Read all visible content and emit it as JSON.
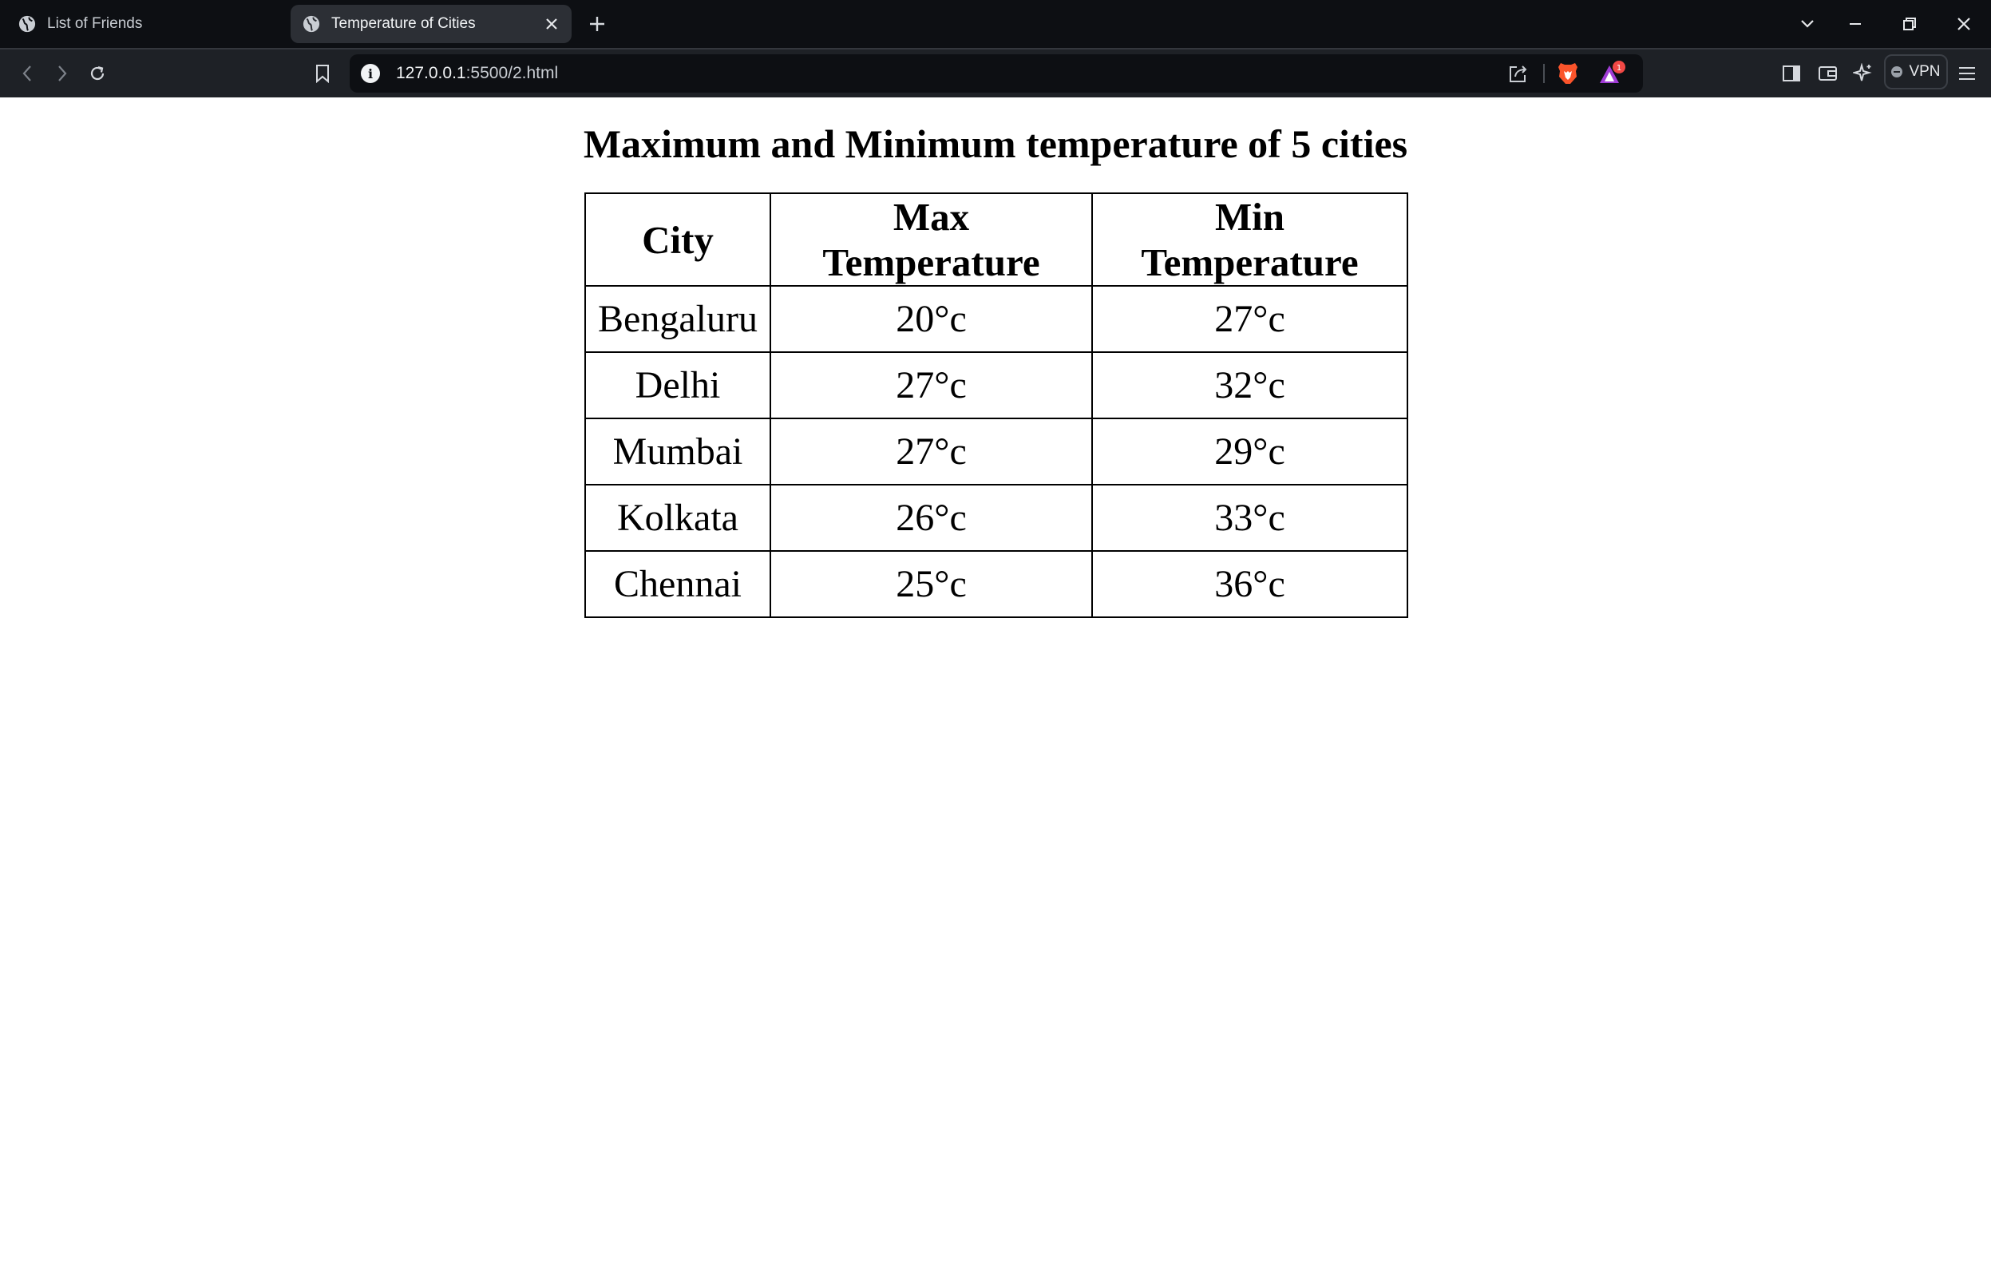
{
  "browser": {
    "tabs": [
      {
        "title": "List of Friends",
        "active": false
      },
      {
        "title": "Temperature of Cities",
        "active": true
      }
    ],
    "address": {
      "host": "127.0.0.1",
      "rest": ":5500/2.html"
    },
    "rewards_badge": "1",
    "vpn_label": "VPN"
  },
  "page": {
    "heading": "Maximum and Minimum temperature of 5 cities",
    "table": {
      "headers": [
        "City",
        "Max Temperature",
        "Min Temperature"
      ],
      "rows": [
        [
          "Bengaluru",
          "20°c",
          "27°c"
        ],
        [
          "Delhi",
          "27°c",
          "32°c"
        ],
        [
          "Mumbai",
          "27°c",
          "29°c"
        ],
        [
          "Kolkata",
          "26°c",
          "33°c"
        ],
        [
          "Chennai",
          "25°c",
          "36°c"
        ]
      ]
    }
  },
  "colors": {
    "tabstrip_bg": "#0d0f13",
    "toolbar_bg": "#1e2126",
    "active_tab_bg": "#2c2f35",
    "brave_orange": "#fb542b"
  }
}
